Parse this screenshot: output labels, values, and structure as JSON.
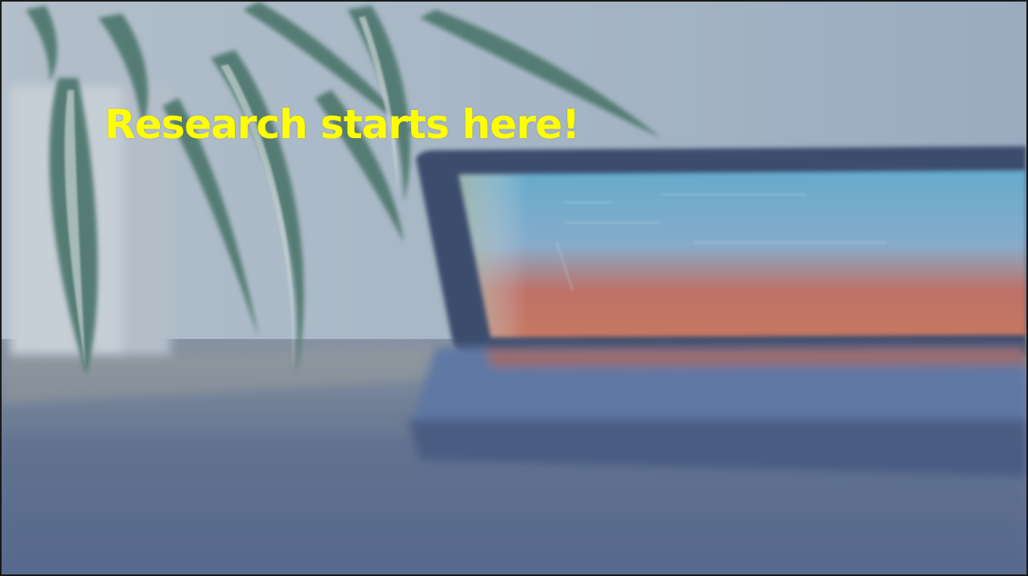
{
  "slide": {
    "headline": "Research starts here!",
    "headline_color": "#ffff00",
    "background_photo": {
      "depicts": "blurred-laptop-and-plant-on-desk",
      "tint_color": "#6f86a8"
    }
  }
}
